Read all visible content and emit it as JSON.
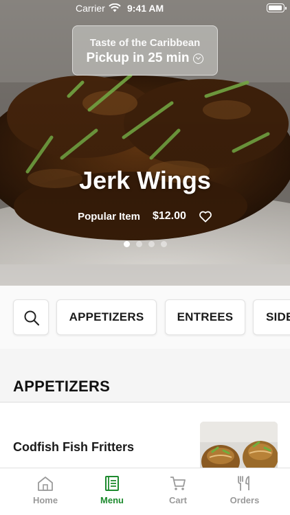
{
  "status_bar": {
    "carrier": "Carrier",
    "time": "9:41 AM"
  },
  "pickup": {
    "title": "Taste of the Caribbean",
    "time_label": "Pickup in 25 min"
  },
  "hero": {
    "title": "Jerk Wings",
    "tag": "Popular Item",
    "price": "$12.00",
    "slides_total": 4,
    "active_slide": 1
  },
  "categories": [
    "APPETIZERS",
    "ENTREES",
    "SIDES"
  ],
  "section": {
    "title": "APPETIZERS"
  },
  "items": [
    {
      "name": "Codfish Fish Fritters"
    }
  ],
  "tabs": [
    {
      "label": "Home",
      "icon": "home-icon"
    },
    {
      "label": "Menu",
      "icon": "menu-book-icon",
      "active": true
    },
    {
      "label": "Cart",
      "icon": "cart-icon"
    },
    {
      "label": "Orders",
      "icon": "fork-knife-icon"
    }
  ],
  "colors": {
    "accent": "#1d8a2e",
    "inactive": "#9a9a9a",
    "text": "#1a1a1a"
  }
}
